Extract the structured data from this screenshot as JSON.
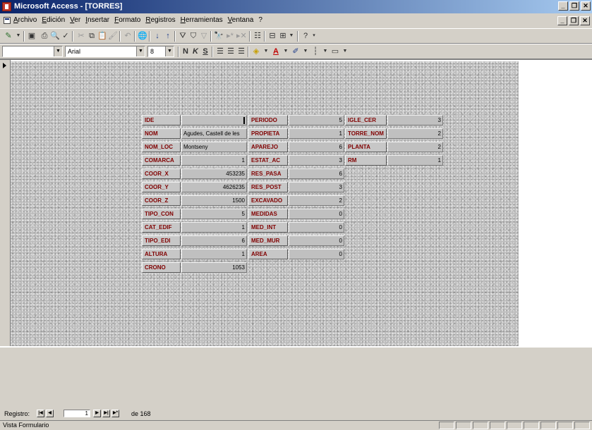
{
  "window": {
    "title": "Microsoft Access - [TORRES]"
  },
  "menu": [
    "Archivo",
    "Edición",
    "Ver",
    "Insertar",
    "Formato",
    "Registros",
    "Herramientas",
    "Ventana",
    "?"
  ],
  "format_toolbar": {
    "object_combo": "",
    "font_combo": "Arial",
    "size_combo": "8"
  },
  "form": {
    "fields": [
      {
        "label": "IDE",
        "value": ""
      },
      {
        "label": "NOM",
        "value": "Agudes, Castell de les"
      },
      {
        "label": "NOM_LOC",
        "value": "Montseny"
      },
      {
        "label": "COMARCA",
        "value": "1"
      },
      {
        "label": "COOR_X",
        "value": "453235"
      },
      {
        "label": "COOR_Y",
        "value": "4626235"
      },
      {
        "label": "COOR_Z",
        "value": "1500"
      },
      {
        "label": "TIPO_CON",
        "value": "5"
      },
      {
        "label": "CAT_EDIF",
        "value": "1"
      },
      {
        "label": "TIPO_EDI",
        "value": "6"
      },
      {
        "label": "ALTURA",
        "value": "1"
      },
      {
        "label": "CRONO",
        "value": "1053"
      },
      {
        "label": "PERIODO",
        "value": "5"
      },
      {
        "label": "PROPIETA",
        "value": "1"
      },
      {
        "label": "APAREJO",
        "value": "6"
      },
      {
        "label": "ESTAT_AC",
        "value": "3"
      },
      {
        "label": "RES_PASA",
        "value": "6"
      },
      {
        "label": "RES_POST",
        "value": "3"
      },
      {
        "label": "EXCAVADO",
        "value": "2"
      },
      {
        "label": "MEDIDAS",
        "value": "0"
      },
      {
        "label": "MED_INT",
        "value": "0"
      },
      {
        "label": "MED_MUR",
        "value": "0"
      },
      {
        "label": "AREA",
        "value": "0"
      },
      {
        "label": "IGLE_CER",
        "value": "3"
      },
      {
        "label": "TORRE_NOM",
        "value": "2"
      },
      {
        "label": "PLANTA",
        "value": "2"
      },
      {
        "label": "RM",
        "value": "1"
      }
    ]
  },
  "navigator": {
    "label": "Registro:",
    "current": "1",
    "total_text": "de 168"
  },
  "status": {
    "text": "Vista Formulario"
  }
}
